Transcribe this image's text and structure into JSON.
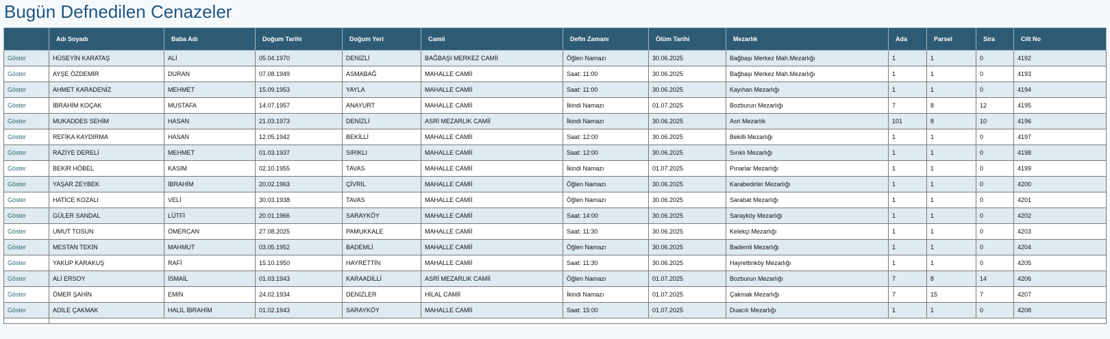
{
  "page_title": "Bugün Defnedilen Cenazeler",
  "columns": [
    "",
    "Adı Soyadı",
    "Baba Adı",
    "Doğum Tarihi",
    "Doğum Yeri",
    "Camii",
    "Defin Zamanı",
    "Ölüm Tarihi",
    "Mezarlık",
    "Ada",
    "Parsel",
    "Sira",
    "Cilt No"
  ],
  "rows": [
    {
      "link": "Göster",
      "name": "HÜSEYİN KARATAŞ",
      "father": "ALİ",
      "birth_date": "05.04.1970",
      "birth_place": "DENİZLİ",
      "mosque": "BAĞBAŞI MERKEZ CAMİİ",
      "burial_time": "Öğlen Namazı",
      "death_date": "30.06.2025",
      "cemetery": "Bağbaşı Merkez Mah.Mezarlığı",
      "ada": "1",
      "parsel": "1",
      "sira": "0",
      "cilt_no": "4192"
    },
    {
      "link": "Göster",
      "name": "AYŞE ÖZDEMİR",
      "father": "DURAN",
      "birth_date": "07.08.1949",
      "birth_place": "ASMABAĞ",
      "mosque": "MAHALLE CAMİİ",
      "burial_time": "Saat: 11:00",
      "death_date": "30.06.2025",
      "cemetery": "Bağbaşı Merkez Mah.Mezarlığı",
      "ada": "1",
      "parsel": "1",
      "sira": "0",
      "cilt_no": "4193"
    },
    {
      "link": "Göster",
      "name": "AHMET KARADENİZ",
      "father": "MEHMET",
      "birth_date": "15.09.1953",
      "birth_place": "YAYLA",
      "mosque": "MAHALLE CAMİİ",
      "burial_time": "Saat: 11:00",
      "death_date": "30.06.2025",
      "cemetery": "Kayıhan Mezarlığı",
      "ada": "1",
      "parsel": "1",
      "sira": "0",
      "cilt_no": "4194"
    },
    {
      "link": "Göster",
      "name": "İBRAHİM KOÇAK",
      "father": "MUSTAFA",
      "birth_date": "14.07.1957",
      "birth_place": "ANAYURT",
      "mosque": "MAHALLE CAMİİ",
      "burial_time": "İkindi Namazı",
      "death_date": "01.07.2025",
      "cemetery": "Bozburun Mezarlığı",
      "ada": "7",
      "parsel": "8",
      "sira": "12",
      "cilt_no": "4195"
    },
    {
      "link": "Göster",
      "name": "MUKADDES SEHİM",
      "father": "HASAN",
      "birth_date": "21.03.1973",
      "birth_place": "DENİZLİ",
      "mosque": "ASRİ MEZARLIK CAMİİ",
      "burial_time": "İkindi Namazı",
      "death_date": "30.06.2025",
      "cemetery": "Asri Mezarlık",
      "ada": "101",
      "parsel": "8",
      "sira": "10",
      "cilt_no": "4196"
    },
    {
      "link": "Göster",
      "name": "REFİKA KAYDIRMA",
      "father": "HASAN",
      "birth_date": "12.05.1942",
      "birth_place": "BEKİLLİ",
      "mosque": "MAHALLE CAMİİ",
      "burial_time": "Saat: 12:00",
      "death_date": "30.06.2025",
      "cemetery": "Bekilli Mezarlığı",
      "ada": "1",
      "parsel": "1",
      "sira": "0",
      "cilt_no": "4197"
    },
    {
      "link": "Göster",
      "name": "RAZİYE DERELİ",
      "father": "MEHMET",
      "birth_date": "01.03.1937",
      "birth_place": "SIRIKLI",
      "mosque": "MAHALLE CAMİİ",
      "burial_time": "Saat: 12:00",
      "death_date": "30.06.2025",
      "cemetery": "Sırıklı Mezarlığı",
      "ada": "1",
      "parsel": "1",
      "sira": "0",
      "cilt_no": "4198"
    },
    {
      "link": "Göster",
      "name": "BEKİR HÖBEL",
      "father": "KASIM",
      "birth_date": "02.10.1955",
      "birth_place": "TAVAS",
      "mosque": "MAHALLE CAMİİ",
      "burial_time": "İkindi Namazı",
      "death_date": "01.07.2025",
      "cemetery": "Pınarlar Mezarlığı",
      "ada": "1",
      "parsel": "1",
      "sira": "0",
      "cilt_no": "4199"
    },
    {
      "link": "Göster",
      "name": "YAŞAR ZEYBEK",
      "father": "İBRAHİM",
      "birth_date": "20.02.1963",
      "birth_place": "ÇİVRİL",
      "mosque": "MAHALLE CAMİİ",
      "burial_time": "Öğlen Namazı",
      "death_date": "30.06.2025",
      "cemetery": "Karabedirler Mezarlığı",
      "ada": "1",
      "parsel": "1",
      "sira": "0",
      "cilt_no": "4200"
    },
    {
      "link": "Göster",
      "name": "HATİCE KOZALI",
      "father": "VELİ",
      "birth_date": "30.03.1938",
      "birth_place": "TAVAS",
      "mosque": "MAHALLE CAMİİ",
      "burial_time": "Öğlen Namazı",
      "death_date": "30.06.2025",
      "cemetery": "Sarabat Mezarlığı",
      "ada": "1",
      "parsel": "1",
      "sira": "0",
      "cilt_no": "4201"
    },
    {
      "link": "Göster",
      "name": "GÜLER SANDAL",
      "father": "LÜTFİ",
      "birth_date": "20.01.1966",
      "birth_place": "SARAYKÖY",
      "mosque": "MAHALLE CAMİİ",
      "burial_time": "Saat: 14:00",
      "death_date": "30.06.2025",
      "cemetery": "Sarayköy Mezarlığı",
      "ada": "1",
      "parsel": "1",
      "sira": "0",
      "cilt_no": "4202"
    },
    {
      "link": "Göster",
      "name": "UMUT TOSUN",
      "father": "ÖMERCAN",
      "birth_date": "27.08.2025",
      "birth_place": "PAMUKKALE",
      "mosque": "MAHALLE CAMİİ",
      "burial_time": "Saat: 11:30",
      "death_date": "30.06.2025",
      "cemetery": "Kelekçi Mezarlığı",
      "ada": "1",
      "parsel": "1",
      "sira": "0",
      "cilt_no": "4203"
    },
    {
      "link": "Göster",
      "name": "MESTAN TEKİN",
      "father": "MAHMUT",
      "birth_date": "03.05.1952",
      "birth_place": "BADEMLİ",
      "mosque": "MAHALLE CAMİİ",
      "burial_time": "Öğlen Namazı",
      "death_date": "30.06.2025",
      "cemetery": "Bademli Mezarlığı",
      "ada": "1",
      "parsel": "1",
      "sira": "0",
      "cilt_no": "4204"
    },
    {
      "link": "Göster",
      "name": "YAKUP KARAKUŞ",
      "father": "RAFİ",
      "birth_date": "15.10.1950",
      "birth_place": "HAYRETTİN",
      "mosque": "MAHALLE CAMİİ",
      "burial_time": "Saat: 11:30",
      "death_date": "30.06.2025",
      "cemetery": "Hayrettinköy Mezarlığı",
      "ada": "1",
      "parsel": "1",
      "sira": "0",
      "cilt_no": "4205"
    },
    {
      "link": "Göster",
      "name": "ALİ ERSOY",
      "father": "İSMAİL",
      "birth_date": "01.03.1943",
      "birth_place": "KARAADİLLİ",
      "mosque": "ASRİ MEZARLIK CAMİİ",
      "burial_time": "Öğlen Namazı",
      "death_date": "01.07.2025",
      "cemetery": "Bozburun Mezarlığı",
      "ada": "7",
      "parsel": "8",
      "sira": "14",
      "cilt_no": "4206"
    },
    {
      "link": "Göster",
      "name": "ÖMER ŞAHİN",
      "father": "EMİN",
      "birth_date": "24.02.1934",
      "birth_place": "DENİZLER",
      "mosque": "HİLAL CAMİİ",
      "burial_time": "İkindi Namazı",
      "death_date": "01.07.2025",
      "cemetery": "Çakmak Mezarlığı",
      "ada": "7",
      "parsel": "15",
      "sira": "7",
      "cilt_no": "4207"
    },
    {
      "link": "Göster",
      "name": "ADİLE ÇAKMAK",
      "father": "HALİL İBRAHİM",
      "birth_date": "01.02.1943",
      "birth_place": "SARAYKÖY",
      "mosque": "MAHALLE CAMİİ",
      "burial_time": "Saat: 15:00",
      "death_date": "01.07.2025",
      "cemetery": "Duacılı Mezarlığı",
      "ada": "1",
      "parsel": "1",
      "sira": "0",
      "cilt_no": "4208"
    }
  ],
  "colors": {
    "title": "#1f5580",
    "header_bg": "#2e5b73",
    "row_alt_bg": "#dfeaf1",
    "link": "#2d6b6b"
  }
}
